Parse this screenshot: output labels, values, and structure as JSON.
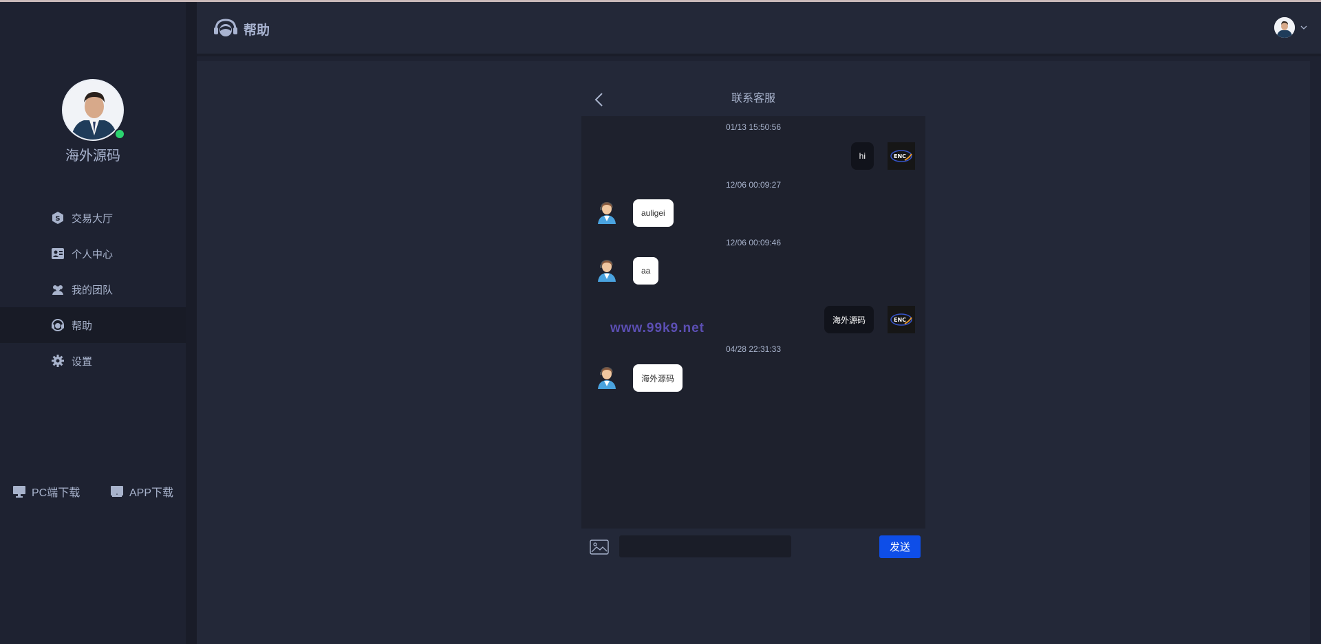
{
  "sidebar": {
    "username": "海外源码",
    "items": [
      {
        "label": "交易大厅",
        "icon": "shield-s-icon"
      },
      {
        "label": "个人中心",
        "icon": "id-card-icon"
      },
      {
        "label": "我的团队",
        "icon": "team-icon"
      },
      {
        "label": "帮助",
        "icon": "headset-icon",
        "active": true
      },
      {
        "label": "设置",
        "icon": "gear-icon"
      }
    ],
    "downloads": [
      {
        "label": "PC端下载",
        "icon": "monitor-icon"
      },
      {
        "label": "APP下载",
        "icon": "tablet-icon"
      }
    ]
  },
  "header": {
    "title": "帮助",
    "icon": "headset-icon"
  },
  "chat": {
    "title": "联系客服",
    "messages": [
      {
        "timestamp": "01/13 15:50:56",
        "direction": "out",
        "text": "hi",
        "avatar": "enc-logo"
      },
      {
        "timestamp": "12/06 00:09:27",
        "direction": "in",
        "text": "auligei",
        "avatar": "agent"
      },
      {
        "timestamp": "12/06 00:09:46",
        "direction": "in",
        "text": "aa",
        "avatar": "agent"
      },
      {
        "timestamp": "",
        "direction": "out",
        "text": "海外源码",
        "avatar": "enc-logo"
      },
      {
        "timestamp": "04/28 22:31:33",
        "direction": "in",
        "text": "海外源码",
        "avatar": "agent"
      }
    ],
    "watermark": "www.99k9.net",
    "input_value": "",
    "send_label": "发送"
  },
  "colors": {
    "accent": "#0e4ee8",
    "online": "#2bd46f",
    "watermark": "#5c4fb4"
  }
}
